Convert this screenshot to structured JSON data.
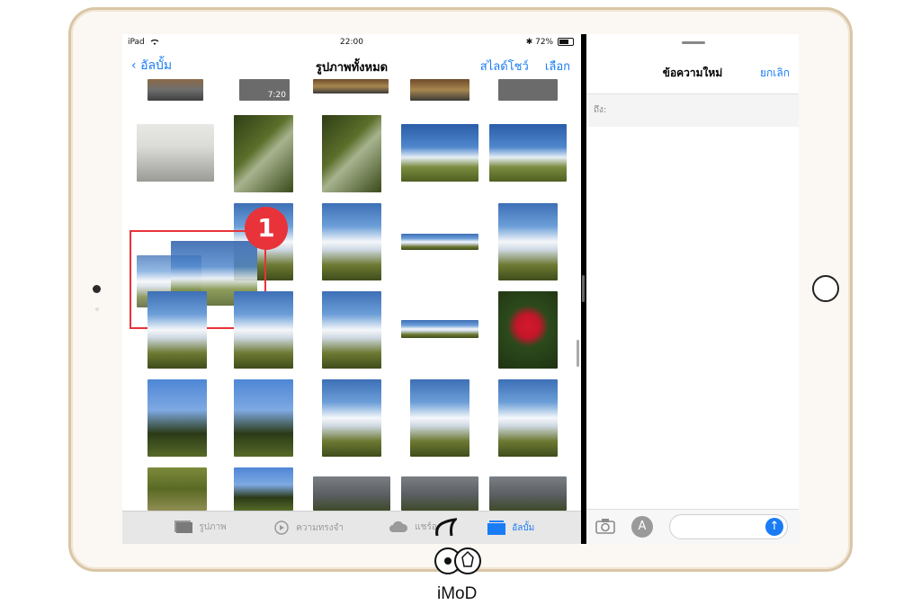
{
  "status_bar": {
    "device": "iPad",
    "time": "22:00",
    "battery": "72%"
  },
  "photos": {
    "back_label": "อัลบั้ม",
    "title": "รูปภาพทั้งหมด",
    "slideshow_label": "สไลด์โชว์",
    "select_label": "เลือก",
    "video_duration": "7:20",
    "drag_badge": "1",
    "tabs": [
      {
        "label": "รูปภาพ",
        "icon": "photos-icon",
        "active": false
      },
      {
        "label": "ความทรงจำ",
        "icon": "memories-icon",
        "active": false
      },
      {
        "label": "แชร์อ",
        "icon": "shared-cloud-icon",
        "active": false
      },
      {
        "label": "อัลบั้ม",
        "icon": "albums-icon",
        "active": true
      }
    ]
  },
  "messages": {
    "title": "ข้อความใหม่",
    "cancel_label": "ยกเลิก",
    "to_label": "ถึง:",
    "send_icon": "arrow-up-icon",
    "camera_icon": "camera-icon",
    "appstore_icon": "app-store-icon"
  },
  "watermark": {
    "text": "iMoD"
  },
  "colors": {
    "accent": "#1a7cf5",
    "highlight": "#e8333a",
    "device_frame": "#d9c6a6"
  }
}
